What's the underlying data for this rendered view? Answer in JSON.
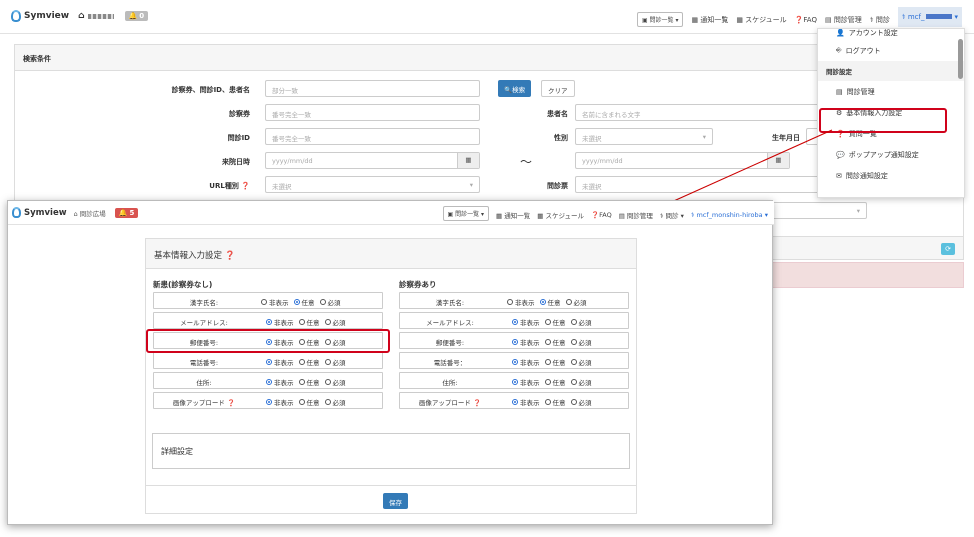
{
  "nav": {
    "brand": "Symview",
    "notif_count": "0",
    "interview_select": "問診一覧",
    "links": [
      "通知一覧",
      "スケジュール",
      "FAQ",
      "問診管理",
      "問診"
    ],
    "user": "mcf_"
  },
  "search": {
    "title": "検索条件",
    "labels": {
      "ticket": "診察券、問診ID、患者名",
      "card": "診察券",
      "id": "問診ID",
      "date": "来院日時",
      "url": "URL種別",
      "patient": "患者名",
      "sex": "性別",
      "birth": "生年月日",
      "ticket2": "問診票"
    },
    "placeholders": {
      "partial": "部分一致",
      "exact": "番号完全一致",
      "name": "名前に含まれる文字",
      "unselected": "未選択",
      "date": "yyyy/mm/dd"
    },
    "search_btn": "検索",
    "clear_btn": "クリア",
    "tilde": "〜"
  },
  "menu": {
    "items_top": [
      "アカウント設定",
      "ログアウト"
    ],
    "section": "問診設定",
    "items": [
      "問診管理",
      "基本情報入力設定",
      "質問一覧",
      "ポップアップ通知設定",
      "問診通知設定"
    ]
  },
  "nav2": {
    "brand": "Symview",
    "site": "問診広場",
    "notif_count": "5",
    "interview_select": "問診一覧",
    "links": [
      "通知一覧",
      "スケジュール",
      "FAQ",
      "問診管理",
      "問診"
    ],
    "user": "mcf_monshin-hiroba"
  },
  "settings": {
    "title": "基本情報入力設定",
    "col1_title": "新患(診察券なし)",
    "col2_title": "診察券あり",
    "options": [
      "非表示",
      "任意",
      "必須"
    ],
    "fields": [
      "漢字氏名:",
      "メールアドレス:",
      "郵便番号:",
      "電話番号:",
      "住所:",
      "画像アップロード"
    ],
    "fields2": [
      "漢字氏名:",
      "メールアドレス:",
      "郵便番号:",
      "電話番号：",
      "住所:",
      "画像アップロード"
    ],
    "col1_selected": [
      1,
      0,
      0,
      0,
      0,
      0
    ],
    "col2_selected": [
      1,
      0,
      0,
      0,
      0,
      0
    ],
    "detail": "詳細設定",
    "save": "保存"
  }
}
